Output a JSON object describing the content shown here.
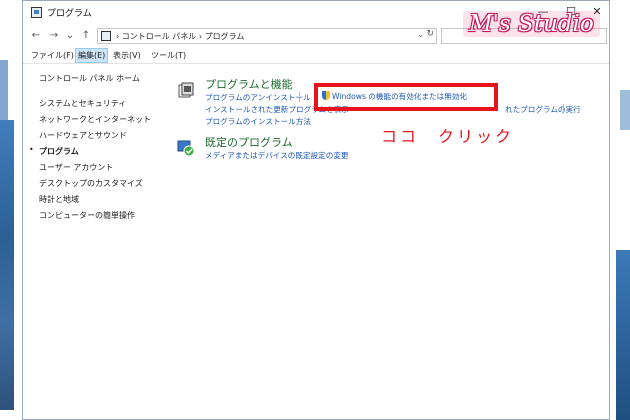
{
  "window": {
    "title": "プログラム",
    "minimize": "—",
    "maximize": "☐",
    "close": "✕"
  },
  "address": {
    "back": "←",
    "forward": "→",
    "recent": "⌄",
    "up": "↑",
    "crumbs": "› コントロール パネル › プログラム",
    "dropdown": "⌄",
    "refresh": "↻",
    "search_placeholder": ""
  },
  "menu": [
    {
      "label": "ファイル(F)"
    },
    {
      "label": "編集(E)"
    },
    {
      "label": "表示(V)"
    },
    {
      "label": "ツール(T)"
    }
  ],
  "sidebar": {
    "items": [
      {
        "label": "コントロール パネル ホーム"
      },
      {
        "label": "システムとセキュリティ"
      },
      {
        "label": "ネットワークとインターネット"
      },
      {
        "label": "ハードウェアとサウンド"
      },
      {
        "label": "プログラム"
      },
      {
        "label": "ユーザー アカウント"
      },
      {
        "label": "デスクトップのカスタマイズ"
      },
      {
        "label": "時計と地域"
      },
      {
        "label": "コンピューターの簡単操作"
      }
    ],
    "bullet": "•"
  },
  "categories": {
    "programs": {
      "title": "プログラムと機能",
      "link1": "プログラムのアンインストール",
      "link_highlight": "Windows の機能の有効化または無効化",
      "link2": "インストールされた更新プログラムを表示",
      "link3": "れたプログラムの実行",
      "link4": "プログラムのインストール方法"
    },
    "defaults": {
      "title": "既定のプログラム",
      "link1": "メディアまたはデバイスの既定設定の変更"
    }
  },
  "annotation": {
    "text": "ココ　クリック"
  },
  "watermark": {
    "text": "M's Studio"
  }
}
